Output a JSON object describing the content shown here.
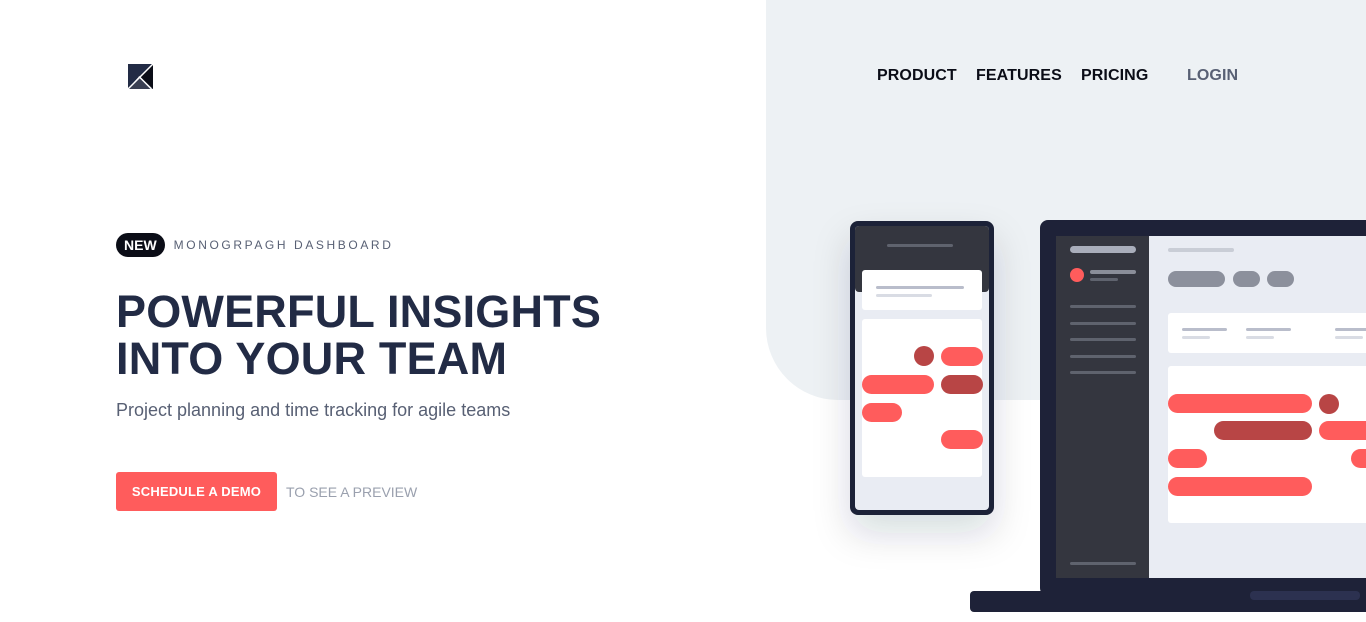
{
  "header": {
    "logo_icon": "k-monogram-logo",
    "nav": {
      "product": "PRODUCT",
      "features": "FEATURES",
      "pricing": "PRICING",
      "login": "LOGIN"
    }
  },
  "hero": {
    "badge": "NEW",
    "badge_text": "MONOGRPAGH DASHBOARD",
    "title_line1": "POWERFUL INSIGHTS",
    "title_line2": "INTO YOUR TEAM",
    "subtitle": "Project planning and time tracking for agile teams",
    "cta_label": "SCHEDULE A DEMO",
    "cta_note": "TO SEE A PREVIEW"
  },
  "colors": {
    "accent": "#ff5c5c",
    "accent_dark": "#b84545",
    "heading": "#222b45",
    "device_frame": "#1e2238",
    "panel_bg": "#edf1f4"
  },
  "illustration": {
    "phone_icon": "mobile-dashboard-illustration",
    "laptop_icon": "laptop-dashboard-illustration"
  }
}
